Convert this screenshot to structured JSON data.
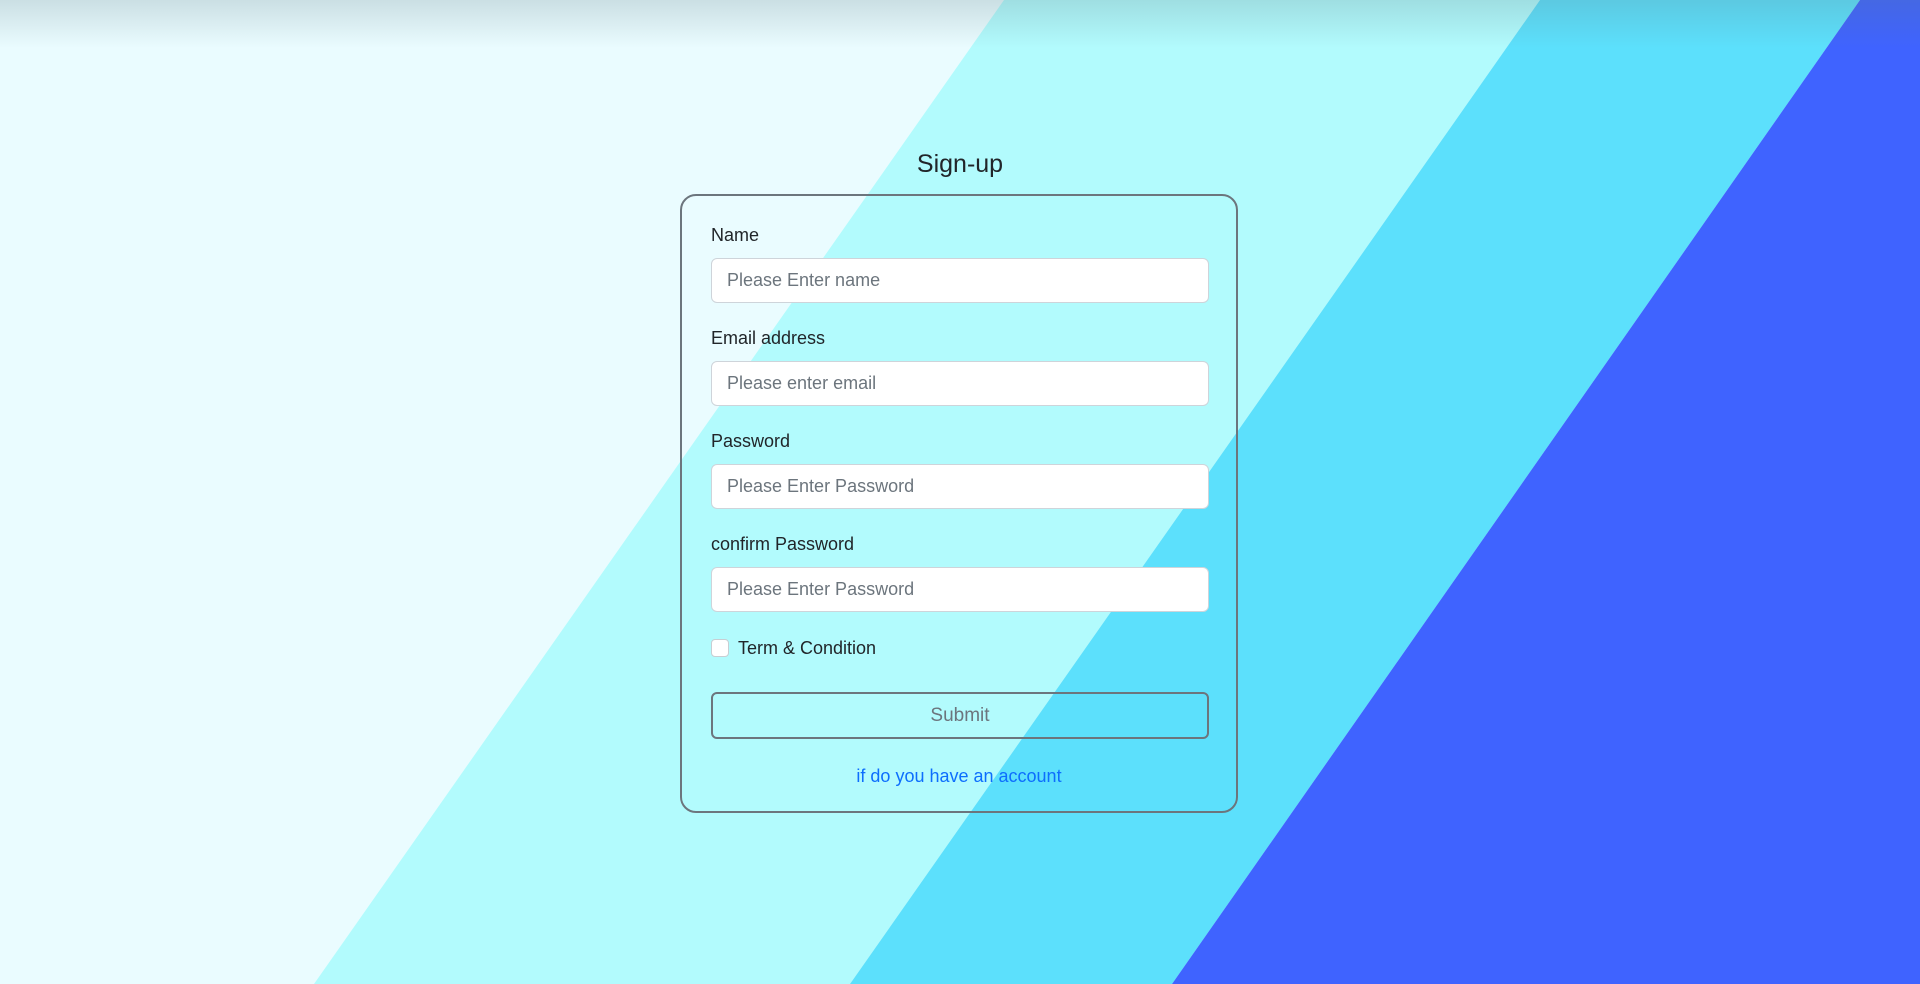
{
  "page": {
    "title": "Sign-up"
  },
  "form": {
    "name": {
      "label": "Name",
      "placeholder": "Please Enter name",
      "value": ""
    },
    "email": {
      "label": "Email address",
      "placeholder": "Please enter email",
      "value": ""
    },
    "password": {
      "label": "Password",
      "placeholder": "Please Enter Password",
      "value": ""
    },
    "confirm_password": {
      "label": "confirm Password",
      "placeholder": "Please Enter Password",
      "value": ""
    },
    "terms": {
      "label": "Term & Condition",
      "checked": false
    },
    "submit_label": "Submit",
    "account_link": "if do you have an account"
  },
  "colors": {
    "background_light": "#eafcff",
    "stripe_aqua": "#b2fbfd",
    "stripe_cyan": "#5ce0fc",
    "stripe_blue": "#3f63ff",
    "link": "#0d6efd",
    "card_border": "#6c757d"
  }
}
